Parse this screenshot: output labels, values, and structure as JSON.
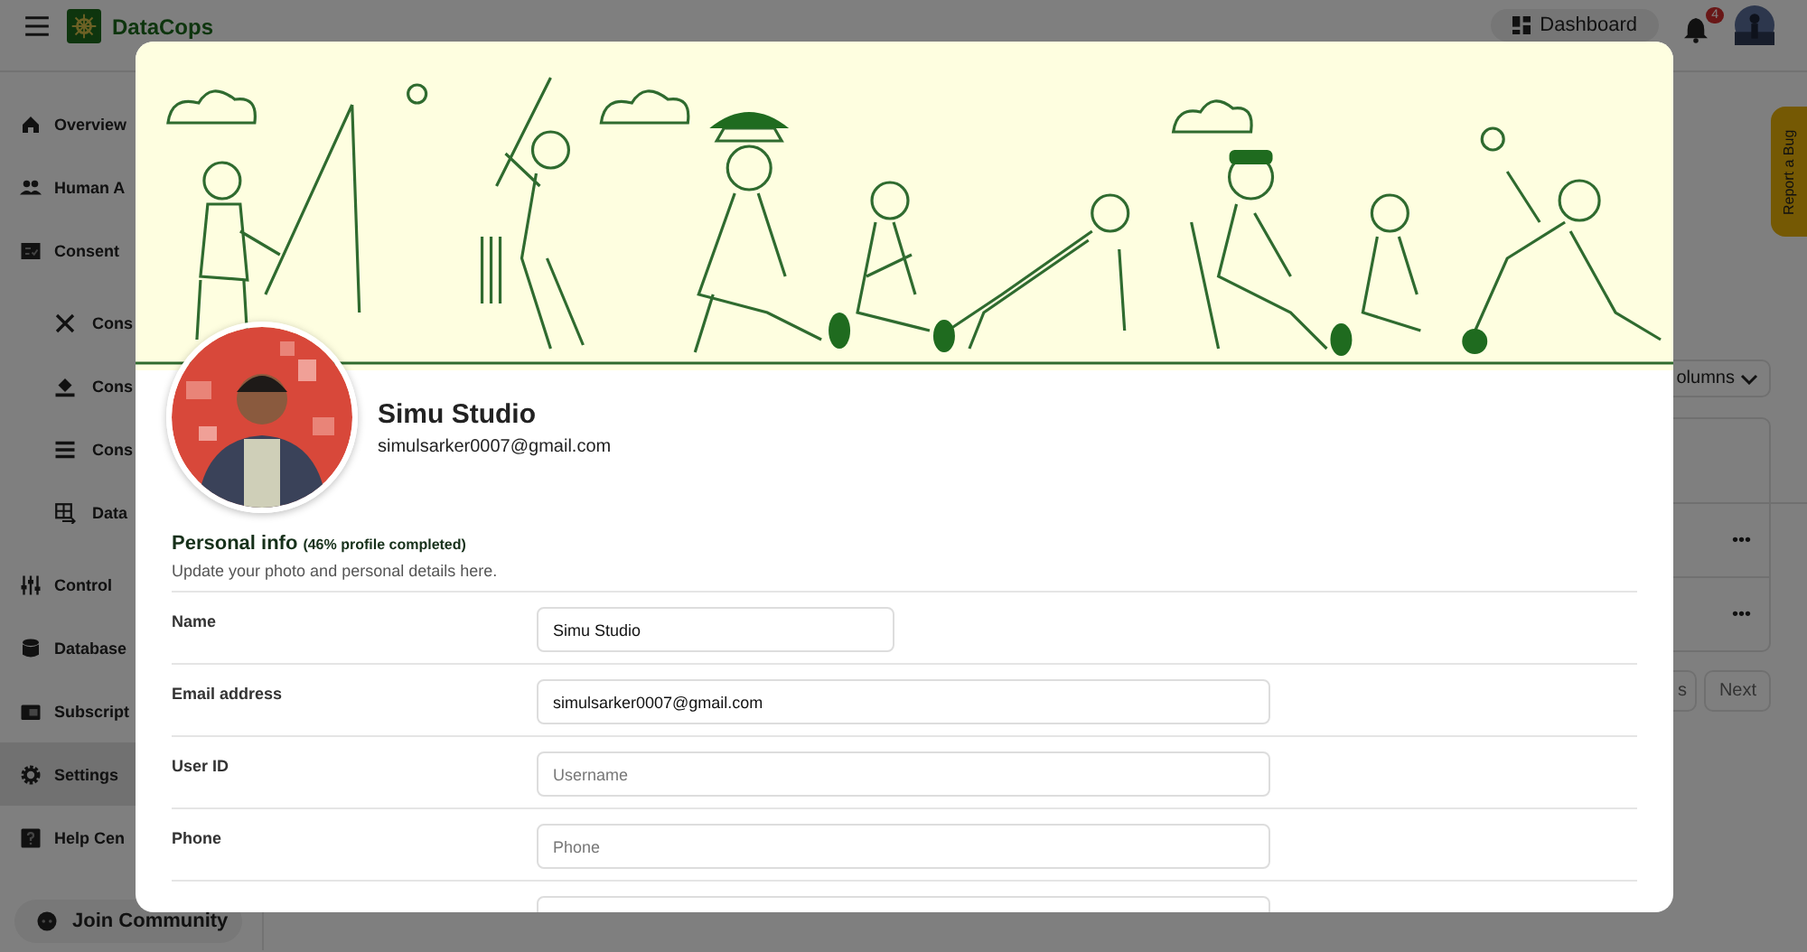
{
  "header": {
    "brand": "DataCops",
    "dashboard_button": "Dashboard",
    "notification_count": "4"
  },
  "sidebar": {
    "items": [
      {
        "label": "Overview",
        "selected": false
      },
      {
        "label": "Human A",
        "selected": false
      },
      {
        "label": "Consent",
        "selected": false,
        "children": [
          {
            "label": "Cons",
            "selected": false
          },
          {
            "label": "Cons",
            "selected": false
          },
          {
            "label": "Cons",
            "selected": false
          },
          {
            "label": "Data",
            "selected": false
          }
        ]
      },
      {
        "label": "Control",
        "selected": false
      },
      {
        "label": "Database",
        "selected": false
      },
      {
        "label": "Subscript",
        "selected": false
      },
      {
        "label": "Settings",
        "selected": true
      },
      {
        "label": "Help Cen",
        "selected": false
      }
    ],
    "footer_button": "Join Community"
  },
  "report_tab": "Report a Bug",
  "background_table": {
    "columns_button": "olumns",
    "row_menus": [
      "•••",
      "•••"
    ],
    "pagination": [
      "s",
      "Next"
    ]
  },
  "profile_modal": {
    "name": "Simu Studio",
    "email": "simulsarker0007@gmail.com",
    "section_title": "Personal info",
    "completion": "(46% profile completed)",
    "section_hint": "Update your photo and personal details here.",
    "fields": [
      {
        "label": "Name",
        "value": "Simu Studio",
        "kind": "short"
      },
      {
        "label": "Email address",
        "value": "simulsarker0007@gmail.com",
        "kind": "long"
      },
      {
        "label": "User ID",
        "placeholder": "Username",
        "kind": "long"
      },
      {
        "label": "Phone",
        "placeholder": "Phone",
        "kind": "long"
      }
    ]
  }
}
